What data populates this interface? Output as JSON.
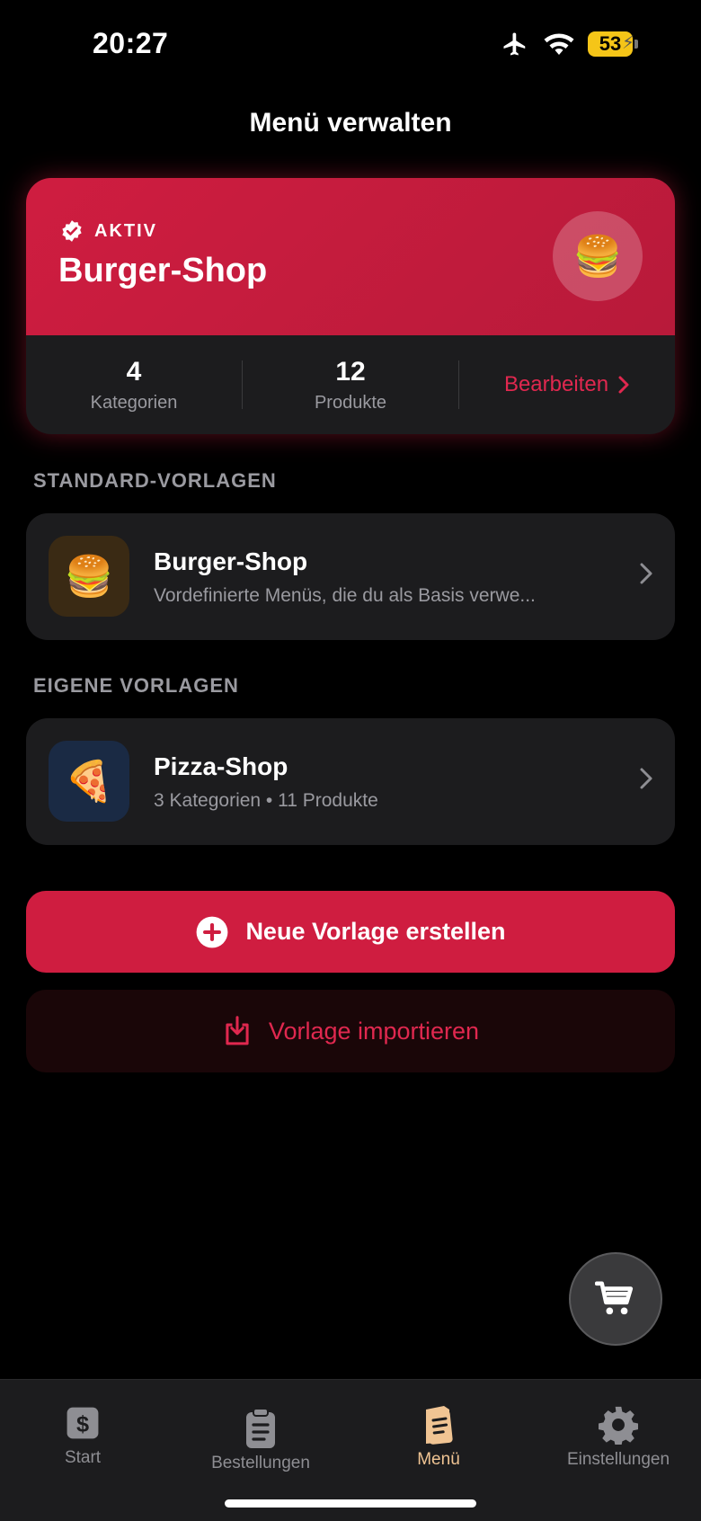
{
  "status_bar": {
    "time": "20:27",
    "battery": "53"
  },
  "header": {
    "title": "Menü verwalten"
  },
  "active_menu": {
    "badge": "AKTIV",
    "name": "Burger-Shop",
    "emoji": "🍔",
    "stats": [
      {
        "value": "4",
        "label": "Kategorien"
      },
      {
        "value": "12",
        "label": "Produkte"
      }
    ],
    "edit_label": "Bearbeiten"
  },
  "standard_templates": {
    "header": "STANDARD-VORLAGEN",
    "items": [
      {
        "emoji": "🍔",
        "name": "Burger-Shop",
        "subtitle": "Vordefinierte Menüs, die du als Basis verwe..."
      }
    ]
  },
  "own_templates": {
    "header": "EIGENE VORLAGEN",
    "items": [
      {
        "emoji": "🍕",
        "name": "Pizza-Shop",
        "subtitle": "3 Kategorien • 11 Produkte"
      }
    ]
  },
  "actions": {
    "create_label": "Neue Vorlage erstellen",
    "import_label": "Vorlage importieren"
  },
  "tab_bar": {
    "items": [
      {
        "label": "Start"
      },
      {
        "label": "Bestellungen"
      },
      {
        "label": "Menü"
      },
      {
        "label": "Einstellungen"
      }
    ]
  },
  "colors": {
    "accent": "#cf1d40",
    "accent_text": "#e0284f",
    "tab_active": "#f0c493",
    "card": "#1c1c1e"
  }
}
